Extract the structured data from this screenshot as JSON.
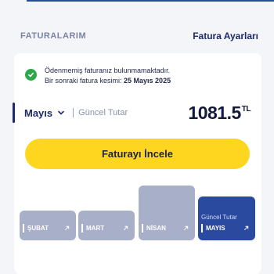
{
  "header": {
    "title": "FATURALARIM",
    "settings_link": "Fatura Ayarları"
  },
  "notice": {
    "line1": "Ödenmemiş faturanız bulunmamaktadır.",
    "line2_prefix": "Bir sonraki fatura kesimi: ",
    "line2_date": "25 Mayıs 2025"
  },
  "summary": {
    "month": "Mayıs",
    "current_label": "Güncel Tutar",
    "amount": "1081.5",
    "currency": "TL"
  },
  "cta": {
    "label": "Faturayı İncele"
  },
  "bars": [
    {
      "label": "ŞUBAT",
      "active": false
    },
    {
      "label": "MART",
      "active": false
    },
    {
      "label": "NİSAN",
      "active": false
    },
    {
      "label": "MAYIS",
      "active": true,
      "sub": "Güncel Tutar"
    }
  ],
  "colors": {
    "accent": "#2a4aa0",
    "cta": "#ffd61f",
    "success": "#2fa64a",
    "bar_inactive": "#a8afc8"
  }
}
